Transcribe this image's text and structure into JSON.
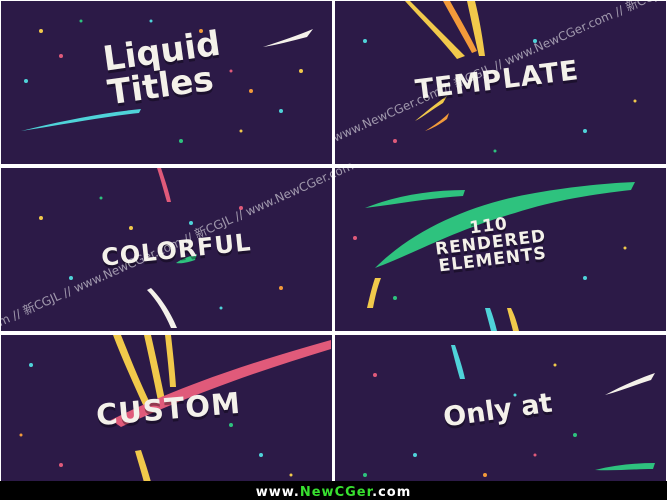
{
  "panels": [
    {
      "lines": [
        "Liquid",
        "Titles"
      ]
    },
    {
      "text": "TEMPLATE"
    },
    {
      "text": "COLORFUL"
    },
    {
      "lines": [
        "110",
        "RENDERED",
        "ELEMENTS"
      ]
    },
    {
      "text": "CUSTOM"
    },
    {
      "text": "Only at"
    }
  ],
  "watermark": {
    "text_a": "Ger.com // 新CGJL // www.NewCGer.com // 新CGJL // www.NewCGer.com",
    "text_b": "www.NewCGer.com // 新CGJL // www.NewCGer.com // 新CGJL //"
  },
  "footer": {
    "prefix": "www.",
    "brand": "NewCGer",
    "suffix": ".com"
  },
  "colors": {
    "panel_bg": "#2c1a47",
    "yellow": "#f1c94b",
    "green": "#2ec27e",
    "pink": "#e05a7a",
    "cyan": "#4fd3d9",
    "orange": "#f29a3a",
    "footer_brand": "#38e02f"
  }
}
